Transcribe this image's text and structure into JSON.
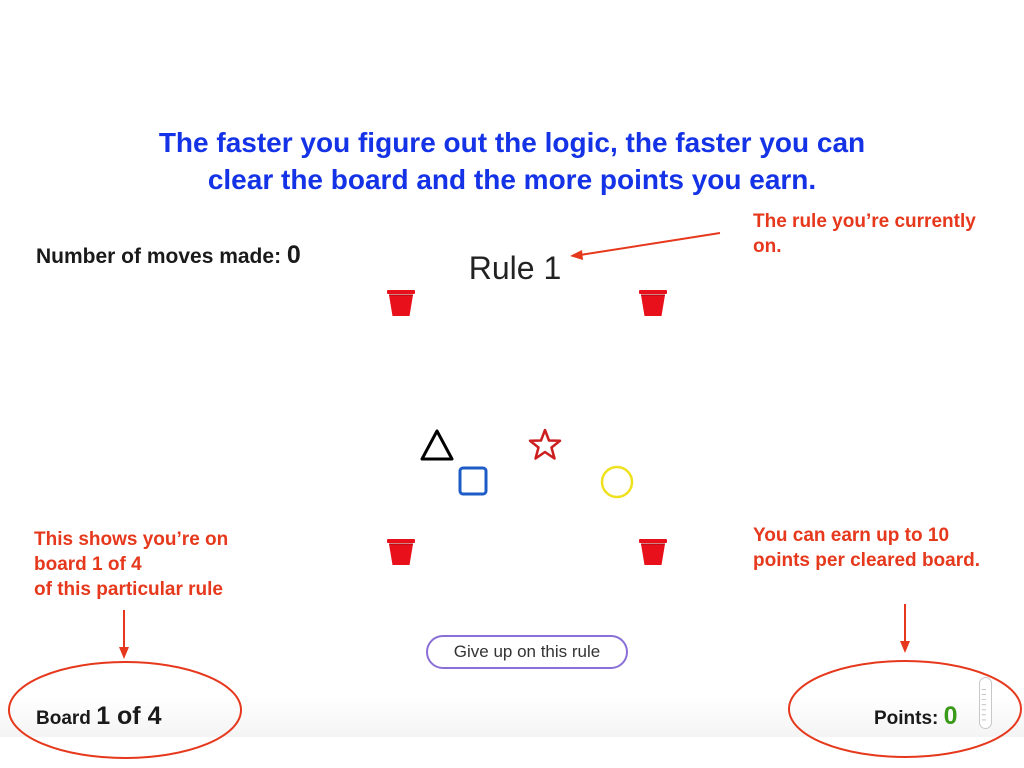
{
  "intro": {
    "line1": "The faster you figure out the logic, the faster you can",
    "line2": "clear the board and the more points you earn."
  },
  "moves": {
    "label": "Number of moves made:",
    "count": "0"
  },
  "rule": {
    "title": "Rule 1"
  },
  "annotations": {
    "rule_note": [
      "The rule you’re currently",
      "on."
    ],
    "board_note": [
      "This shows you’re on",
      "board 1 of 4",
      "of this particular rule"
    ],
    "points_note": [
      "You can earn up to 10",
      "points per cleared board."
    ]
  },
  "give_up": {
    "label": "Give up on this rule"
  },
  "board": {
    "label": "Board",
    "value": "1 of 4"
  },
  "points": {
    "label": "Points:",
    "value": "0"
  },
  "shapes": [
    {
      "name": "triangle",
      "color": "#000000"
    },
    {
      "name": "star",
      "color": "#cc1e1e"
    },
    {
      "name": "square",
      "color": "#1d5bc7"
    },
    {
      "name": "circle",
      "color": "#f0e11e"
    }
  ],
  "colors": {
    "intro_text": "#1432e6",
    "annotation": "#e6381c",
    "bucket": "#e8101a",
    "points_value": "#3a9a1a",
    "give_up_border": "#8a6fd6"
  }
}
